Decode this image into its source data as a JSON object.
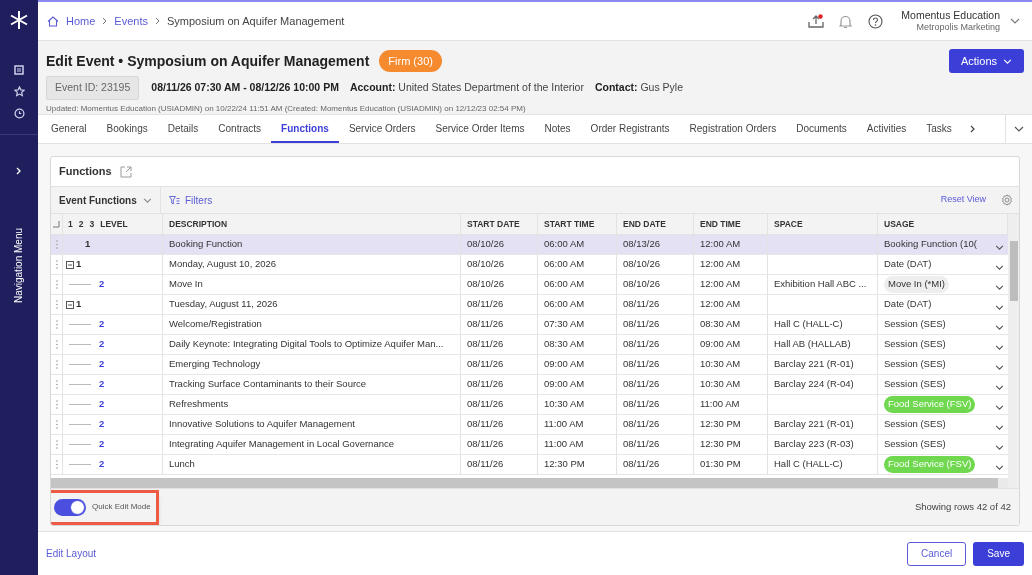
{
  "breadcrumb": [
    {
      "label": "Home",
      "link": true
    },
    {
      "label": "Events",
      "link": true
    },
    {
      "label": "Symposium on Aquifer Management",
      "link": false
    }
  ],
  "user": {
    "name": "Momentus Education",
    "org": "Metropolis Marketing"
  },
  "sidebar": {
    "label": "Navigation Menu"
  },
  "event": {
    "title": "Edit Event • Symposium on Aquifer Management",
    "status": "Firm (30)",
    "id": "Event ID: 23195",
    "dates": "08/11/26 07:30 AM - 08/12/26 10:00 PM",
    "account_label": "Account:",
    "account": "United States Department of the Interior",
    "contact_label": "Contact:",
    "contact": "Gus Pyle",
    "updated": "Updated:  Momentus Education (USIADMIN) on 10/22/24 11:51 AM (Created: Momentus Education (USIADMIN) on 12/12/23 02:54 PM)",
    "actions": "Actions"
  },
  "tabs": [
    {
      "label": "General",
      "selected": false
    },
    {
      "label": "Bookings",
      "selected": false
    },
    {
      "label": "Details",
      "selected": false
    },
    {
      "label": "Contracts",
      "selected": false
    },
    {
      "label": "Functions",
      "selected": true
    },
    {
      "label": "Service Orders",
      "selected": false
    },
    {
      "label": "Service Order Items",
      "selected": false
    },
    {
      "label": "Notes",
      "selected": false
    },
    {
      "label": "Order Registrants",
      "selected": false
    },
    {
      "label": "Registration Orders",
      "selected": false
    },
    {
      "label": "Documents",
      "selected": false
    },
    {
      "label": "Activities",
      "selected": false
    },
    {
      "label": "Tasks",
      "selected": false
    }
  ],
  "panel": {
    "title": "Functions",
    "view": "Event Functions",
    "filters": "Filters",
    "reset": "Reset View",
    "level_buttons": [
      "1",
      "2",
      "3"
    ],
    "columns": [
      "LEVEL",
      "DESCRIPTION",
      "START DATE",
      "START TIME",
      "END DATE",
      "END TIME",
      "SPACE",
      "USAGE"
    ],
    "rows": [
      {
        "level": "1",
        "description": "Booking Function",
        "start_date": "08/10/26",
        "start_time": "06:00 AM",
        "end_date": "08/13/26",
        "end_time": "12:00 AM",
        "usage": "Booking Function (10(",
        "selected": true
      },
      {
        "level": "1",
        "expanded": true,
        "description": "Monday, August 10, 2026",
        "start_date": "08/10/26",
        "start_time": "06:00 AM",
        "end_date": "08/10/26",
        "end_time": "12:00 AM",
        "usage": "Date (DAT)",
        "selected": false,
        "children": [
          {
            "level": "2",
            "description": "Move In",
            "start_date": "08/10/26",
            "start_time": "06:00 AM",
            "end_date": "08/10/26",
            "end_time": "12:00 AM",
            "space": "Exhibition Hall ABC ...",
            "usage": "Move In (*MI)",
            "color": "#eeeeee",
            "selected": false
          }
        ]
      },
      {
        "level": "1",
        "expanded": true,
        "description": "Tuesday, August 11, 2026",
        "start_date": "08/11/26",
        "start_time": "06:00 AM",
        "end_date": "08/11/26",
        "end_time": "12:00 AM",
        "usage": "Date (DAT)",
        "selected": false,
        "children": [
          {
            "level": "2",
            "description": "Welcome/Registration",
            "start_date": "08/11/26",
            "start_time": "07:30 AM",
            "end_date": "08/11/26",
            "end_time": "08:30 AM",
            "space": "Hall C (HALL-C)",
            "usage": "Session (SES)",
            "selected": false
          },
          {
            "level": "2",
            "description": "Daily Keynote: Integrating Digital Tools to Optimize Aquifer Man...",
            "start_date": "08/11/26",
            "start_time": "08:30 AM",
            "end_date": "08/11/26",
            "end_time": "09:00 AM",
            "space": "Hall AB (HALLAB)",
            "usage": "Session (SES)",
            "selected": false
          },
          {
            "level": "2",
            "description": "Emerging Technology",
            "start_date": "08/11/26",
            "start_time": "09:00 AM",
            "end_date": "08/11/26",
            "end_time": "10:30 AM",
            "space": "Barclay 221 (R-01)",
            "usage": "Session (SES)",
            "selected": false
          },
          {
            "level": "2",
            "description": "Tracking Surface Contaminants to their Source",
            "start_date": "08/11/26",
            "start_time": "09:00 AM",
            "end_date": "08/11/26",
            "end_time": "10:30 AM",
            "space": "Barclay 224 (R-04)",
            "usage": "Session (SES)",
            "selected": false
          },
          {
            "level": "2",
            "description": "Refreshments",
            "start_date": "08/11/26",
            "start_time": "10:30 AM",
            "end_date": "08/11/26",
            "end_time": "11:00 AM",
            "usage": "Food Service (FSV)",
            "color": "#6fd84f",
            "selected": false
          },
          {
            "level": "2",
            "description": "Innovative Solutions to Aquifer Management",
            "start_date": "08/11/26",
            "start_time": "11:00 AM",
            "end_date": "08/11/26",
            "end_time": "12:30 PM",
            "space": "Barclay 221 (R-01)",
            "usage": "Session (SES)",
            "selected": false
          },
          {
            "level": "2",
            "description": "Integrating Aquifer Management in Local Governance",
            "start_date": "08/11/26",
            "start_time": "11:00 AM",
            "end_date": "08/11/26",
            "end_time": "12:30 PM",
            "space": "Barclay 223 (R-03)",
            "usage": "Session (SES)",
            "selected": false
          },
          {
            "level": "2",
            "description": "Lunch",
            "start_date": "08/11/26",
            "start_time": "12:30 PM",
            "end_date": "08/11/26",
            "end_time": "01:30 PM",
            "space": "Hall C (HALL-C)",
            "usage": "Food Service (FSV)",
            "color": "#6fd84f",
            "selected": false
          }
        ]
      }
    ],
    "quick_edit": {
      "label": "Quick Edit Mode",
      "on": true
    },
    "row_count": "Showing rows 42 of 42"
  },
  "footer": {
    "edit_layout": "Edit Layout",
    "cancel": "Cancel",
    "save": "Save"
  }
}
